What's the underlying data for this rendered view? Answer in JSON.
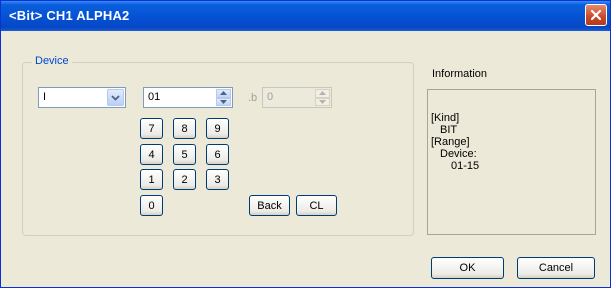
{
  "window": {
    "title": "<Bit> CH1 ALPHA2"
  },
  "device_group": {
    "label": "Device",
    "type_select": {
      "value": "I"
    },
    "device_number": {
      "value": "01"
    },
    "bit_separator": ".b",
    "bit_number": {
      "value": "0"
    },
    "keypad": [
      "7",
      "8",
      "9",
      "4",
      "5",
      "6",
      "1",
      "2",
      "3",
      "0"
    ],
    "back_label": "Back",
    "clear_label": "CL"
  },
  "information": {
    "label": "Information",
    "kind_heading": "[Kind]",
    "kind_value": "BIT",
    "range_heading": "[Range]",
    "range_device_label": "Device:",
    "range_device_value": "01-15"
  },
  "footer": {
    "ok_label": "OK",
    "cancel_label": "Cancel"
  }
}
